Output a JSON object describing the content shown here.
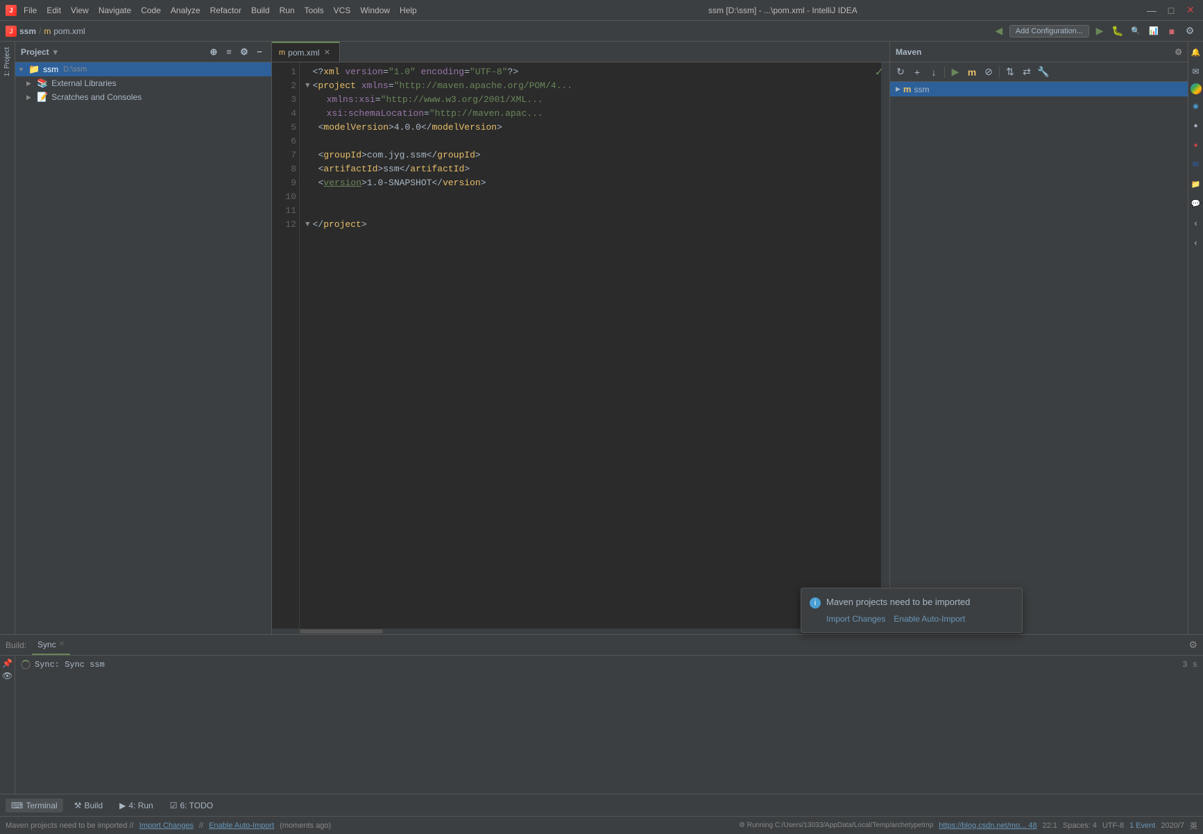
{
  "window": {
    "title": "ssm [D:\\ssm] - ...\\pom.xml - IntelliJ IDEA",
    "minimize": "—",
    "maximize": "□",
    "close": "✕"
  },
  "menubar": {
    "menus": [
      "File",
      "Edit",
      "View",
      "Navigate",
      "Code",
      "Analyze",
      "Refactor",
      "Build",
      "Run",
      "Tools",
      "VCS",
      "Window",
      "Help"
    ],
    "run_config": "Add Configuration...",
    "breadcrumb_ssm": "ssm",
    "breadcrumb_pom": "pom.xml"
  },
  "project_panel": {
    "title": "Project",
    "items": [
      {
        "label": "ssm",
        "sublabel": "D:\\ssm",
        "icon": "📁",
        "type": "root",
        "selected": true
      },
      {
        "label": "External Libraries",
        "icon": "📚",
        "type": "libraries"
      },
      {
        "label": "Scratches and Consoles",
        "icon": "📝",
        "type": "scratches"
      }
    ]
  },
  "editor": {
    "tab_label": "pom.xml",
    "lines": [
      {
        "num": 1,
        "content": "<?xml version=\"1.0\" encoding=\"UTF-8\"?>"
      },
      {
        "num": 2,
        "content": "<project xmlns=\"http://maven.apache.org/POM/4..."
      },
      {
        "num": 3,
        "content": "         xmlns:xsi=\"http://www.w3.org/2001/XML..."
      },
      {
        "num": 4,
        "content": "         xsi:schemaLocation=\"http://maven.apac..."
      },
      {
        "num": 5,
        "content": "    <modelVersion>4.0.0</modelVersion>"
      },
      {
        "num": 6,
        "content": ""
      },
      {
        "num": 7,
        "content": "    <groupId>com.jyg.ssm</groupId>"
      },
      {
        "num": 8,
        "content": "    <artifactId>ssm</artifactId>"
      },
      {
        "num": 9,
        "content": "    <version>1.0-SNAPSHOT</version>"
      },
      {
        "num": 10,
        "content": ""
      },
      {
        "num": 11,
        "content": ""
      },
      {
        "num": 12,
        "content": "</project>"
      }
    ]
  },
  "maven_panel": {
    "title": "Maven",
    "items": [
      {
        "label": "ssm",
        "icon": "m"
      }
    ]
  },
  "build_panel": {
    "label": "Build:",
    "tab_label": "Sync",
    "log_line": "Sync: Sync ssm",
    "time": "3 s"
  },
  "bottom_toolbar": {
    "tabs": [
      {
        "label": "Terminal",
        "icon": ">_"
      },
      {
        "label": "Build",
        "icon": "⚒"
      },
      {
        "label": "4: Run",
        "icon": "▶"
      },
      {
        "label": "6: TODO",
        "icon": "☑"
      }
    ]
  },
  "status_bar": {
    "message": "Maven projects need to be imported // Import Changes // Enable Auto-Import (moments ago)",
    "running": "Running C:/Users/13033/AppData/Local/Temp/archetypetmp",
    "link": "https://blog.csdn.net/mo... 48",
    "event": "1 Event",
    "position": "22:1",
    "date": "2020/7",
    "encoding": "英"
  },
  "notification": {
    "title": "Maven projects need to be imported",
    "import_label": "Import Changes",
    "auto_import_label": "Enable Auto-Import",
    "icon": "i"
  },
  "colors": {
    "accent_green": "#6a8759",
    "accent_blue": "#2d6099",
    "accent_purple": "#9876aa",
    "tag_color": "#e8bf6a",
    "link_color": "#6897bb"
  }
}
